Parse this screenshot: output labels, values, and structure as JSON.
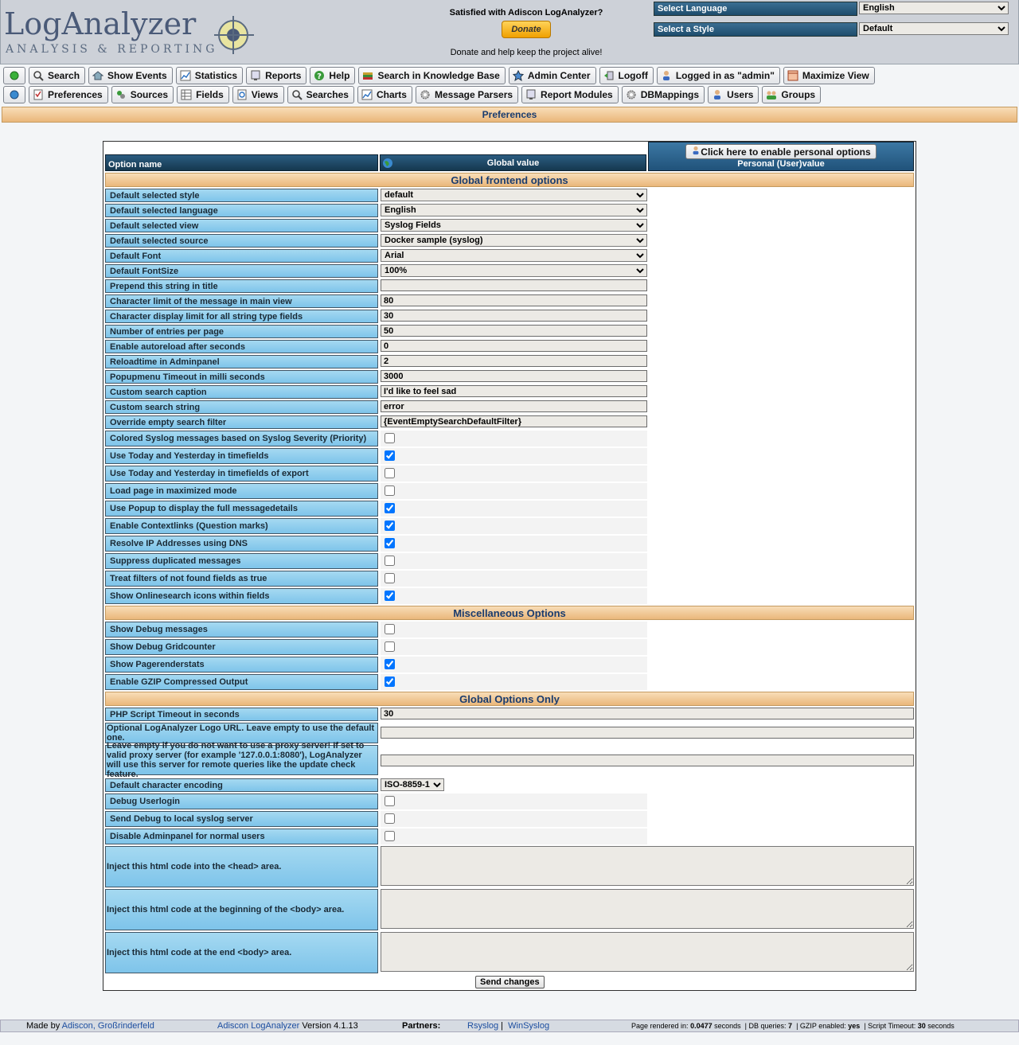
{
  "header": {
    "logo_main": "LogAnalyzer",
    "logo_sub": "ANALYSIS & REPORTING",
    "donate_prompt": "Satisfied with Adiscon LogAnalyzer?",
    "donate_button": "Donate",
    "donate_footer": "Donate and help keep the project alive!",
    "language_label": "Select Language",
    "language_value": "English",
    "style_label": "Select a Style",
    "style_value": "Default"
  },
  "menu1": [
    "Search",
    "Show Events",
    "Statistics",
    "Reports",
    "Help",
    "Search in Knowledge Base",
    "Admin Center",
    "Logoff",
    "Logged in as \"admin\"",
    "Maximize View"
  ],
  "menu2": [
    "Preferences",
    "Sources",
    "Fields",
    "Views",
    "Searches",
    "Charts",
    "Message Parsers",
    "Report Modules",
    "DBMappings",
    "Users",
    "Groups"
  ],
  "page_title": "Preferences",
  "table_header": {
    "option_name": "Option name",
    "global_value": "Global value",
    "personal_button": "Click here to enable personal options",
    "personal_value": "Personal (User)value"
  },
  "sections": {
    "frontend": "Global frontend options",
    "misc": "Miscellaneous Options",
    "global_only": "Global Options Only"
  },
  "options": {
    "style": {
      "label": "Default selected style",
      "value": "default"
    },
    "language": {
      "label": "Default selected language",
      "value": "English"
    },
    "view": {
      "label": "Default selected view",
      "value": "Syslog Fields"
    },
    "source": {
      "label": "Default selected source",
      "value": "Docker sample (syslog)"
    },
    "font": {
      "label": "Default Font",
      "value": "Arial"
    },
    "fontsize": {
      "label": "Default FontSize",
      "value": "100%"
    },
    "prepend": {
      "label": "Prepend this string in title",
      "value": ""
    },
    "charlimit": {
      "label": "Character limit of the message in main view",
      "value": "80"
    },
    "strlimit": {
      "label": "Character display limit for all string type fields",
      "value": "30"
    },
    "entries": {
      "label": "Number of entries per page",
      "value": "50"
    },
    "autoreload": {
      "label": "Enable autoreload after seconds",
      "value": "0"
    },
    "reloadtime": {
      "label": "Reloadtime in Adminpanel",
      "value": "2"
    },
    "popup_timeout": {
      "label": "Popupmenu Timeout in milli seconds",
      "value": "3000"
    },
    "search_caption": {
      "label": "Custom search caption",
      "value": "I'd like to feel sad"
    },
    "search_string": {
      "label": "Custom search string",
      "value": "error"
    },
    "empty_filter": {
      "label": "Override empty search filter",
      "value": "{EventEmptySearchDefaultFilter}"
    }
  },
  "frontend_checks": [
    {
      "label": "Colored Syslog messages based on Syslog Severity (Priority)",
      "checked": false
    },
    {
      "label": "Use Today and Yesterday in timefields",
      "checked": true
    },
    {
      "label": "Use Today and Yesterday in timefields of export",
      "checked": false
    },
    {
      "label": "Load page in maximized mode",
      "checked": false
    },
    {
      "label": "Use Popup to display the full messagedetails",
      "checked": true
    },
    {
      "label": "Enable Contextlinks (Question marks)",
      "checked": true
    },
    {
      "label": "Resolve IP Addresses using DNS",
      "checked": true
    },
    {
      "label": "Suppress duplicated messages",
      "checked": false
    },
    {
      "label": "Treat filters of not found fields as true",
      "checked": false
    },
    {
      "label": "Show Onlinesearch icons within fields",
      "checked": true
    }
  ],
  "misc_checks": [
    {
      "label": "Show Debug messages",
      "checked": false
    },
    {
      "label": "Show Debug Gridcounter",
      "checked": false
    },
    {
      "label": "Show Pagerenderstats",
      "checked": true
    },
    {
      "label": "Enable GZIP Compressed Output",
      "checked": true
    }
  ],
  "global_only": {
    "timeout": {
      "label": "PHP Script Timeout in seconds",
      "value": "30"
    },
    "logo_url": {
      "label": "Optional LogAnalyzer Logo URL. Leave empty to use the default one.",
      "value": ""
    },
    "proxy": {
      "label": "Leave empty if you do not want to use a proxy server! If set to valid proxy server (for example '127.0.0.1:8080'), LogAnalyzer will use this server for remote queries like the update check feature.",
      "value": ""
    },
    "encoding": {
      "label": "Default character encoding",
      "value": "ISO-8859-1"
    },
    "checks": [
      {
        "label": "Debug Userlogin",
        "checked": false
      },
      {
        "label": "Send Debug to local syslog server",
        "checked": false
      },
      {
        "label": "Disable Adminpanel for normal users",
        "checked": false
      }
    ],
    "inject_head": "Inject this html code into the <head> area.",
    "inject_body_begin": "Inject this html code at the beginning of the <body> area.",
    "inject_body_end": "Inject this html code at the end <body> area."
  },
  "send_button": "Send changes",
  "footer": {
    "made_by": "Made by",
    "made_by_link": "Adiscon, Großrinderfeld",
    "product_link": "Adiscon LogAnalyzer",
    "version": "Version 4.1.13",
    "partners": "Partners:",
    "partner1": "Rsyslog",
    "partner2": "WinSyslog",
    "stats": {
      "rendered_label": "Page rendered in:",
      "rendered_value": "0.0477",
      "seconds": "seconds",
      "dbq_label": "DB queries:",
      "dbq_value": "7",
      "gzip_label": "GZIP enabled:",
      "gzip_value": "yes",
      "timeout_label": "Script Timeout:",
      "timeout_value": "30"
    }
  },
  "colors": {
    "accent": "#1d4c6c",
    "label_bg": "#a5d9f1",
    "section": "#eab77a"
  }
}
